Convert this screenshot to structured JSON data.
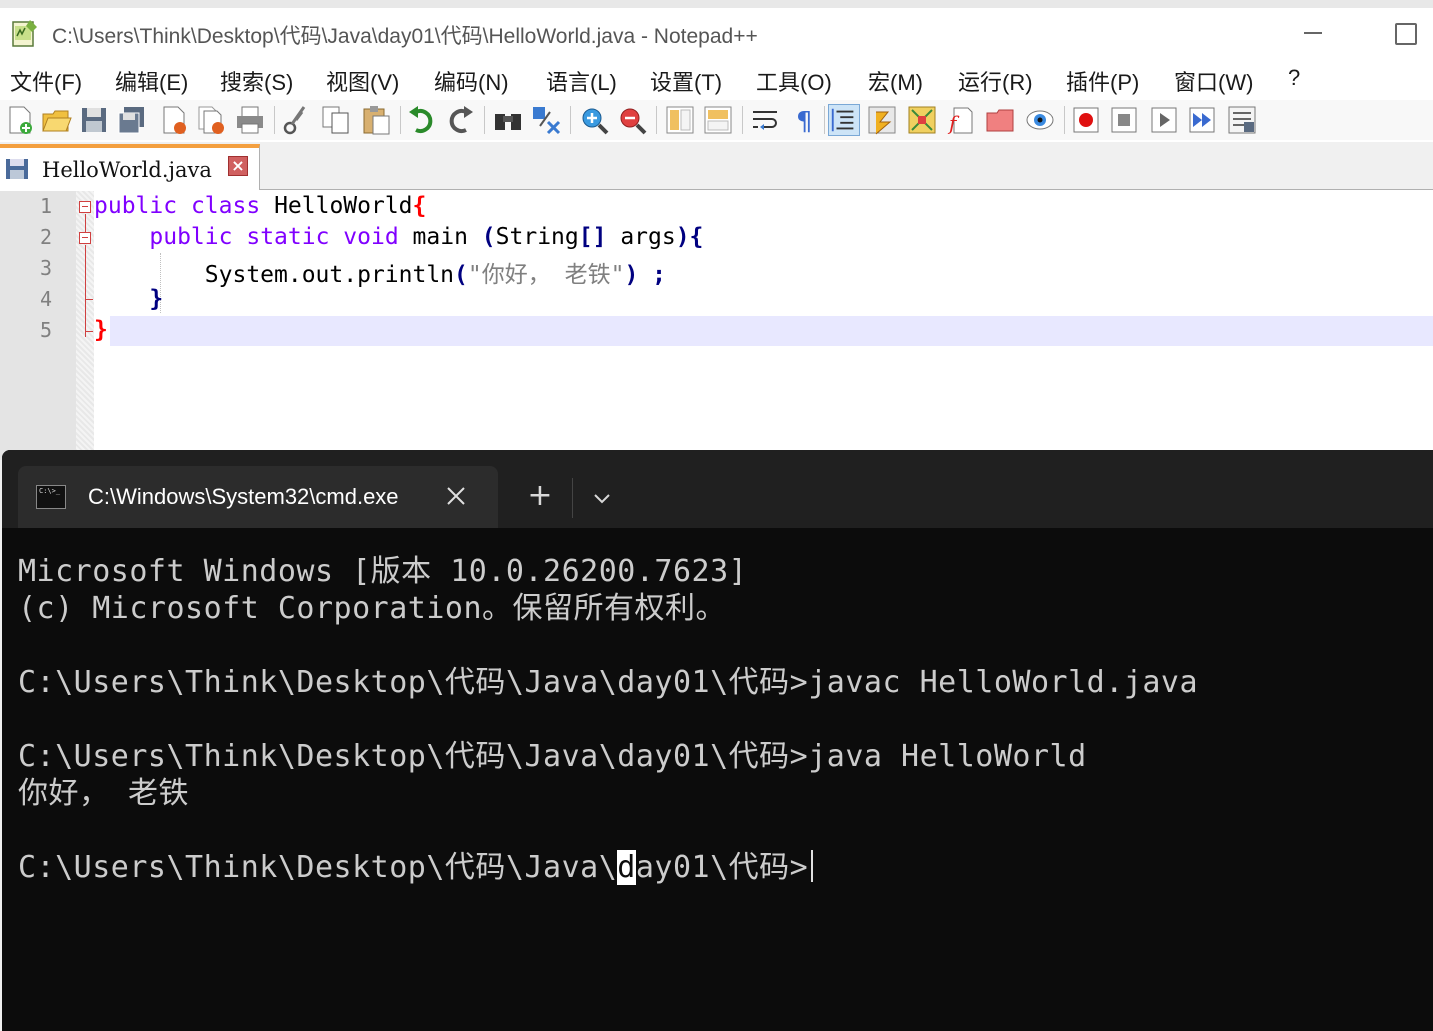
{
  "notepad": {
    "title": "C:\\Users\\Think\\Desktop\\代码\\Java\\day01\\代码\\HelloWorld.java - Notepad++",
    "menu": [
      "文件(F)",
      "编辑(E)",
      "搜索(S)",
      "视图(V)",
      "编码(N)",
      "语言(L)",
      "设置(T)",
      "工具(O)",
      "宏(M)",
      "运行(R)",
      "插件(P)",
      "窗口(W)",
      "?"
    ],
    "tab": {
      "label": "HelloWorld.java",
      "close": "×"
    },
    "line_numbers": [
      "1",
      "2",
      "3",
      "4",
      "5"
    ],
    "code": {
      "l1_kw1": "public",
      "l1_kw2": "class",
      "l1_name": "HelloWorld",
      "l1_brace": "{",
      "l2_kw1": "public",
      "l2_kw2": "static",
      "l2_kw3": "void",
      "l2_name": "main",
      "l2_paren_open": "(",
      "l2_type": "String",
      "l2_brackets": "[]",
      "l2_arg": "args",
      "l2_paren_close": "){",
      "l3_call": "System.out.println",
      "l3_paren_open": "(",
      "l3_string": "\"你好， 老铁\"",
      "l3_paren_close": ")",
      "l3_semi": ";",
      "l4_brace": "}",
      "l5_brace": "}"
    },
    "toolbar_icons": [
      "new-file-icon",
      "open-file-icon",
      "save-icon",
      "save-all-icon",
      "close-icon",
      "close-all-icon",
      "print-icon",
      "cut-icon",
      "copy-icon",
      "paste-icon",
      "undo-icon",
      "redo-icon",
      "find-icon",
      "replace-icon",
      "zoom-in-icon",
      "zoom-out-icon",
      "sync-vertical-icon",
      "sync-horizontal-icon",
      "word-wrap-icon",
      "show-all-chars-icon",
      "indent-guide-icon",
      "udl-icon",
      "doc-map-icon",
      "function-list-icon",
      "folder-workspace-icon",
      "monitoring-icon",
      "record-macro-icon",
      "stop-record-icon",
      "play-macro-icon",
      "run-macro-multiple-icon",
      "save-macro-icon"
    ]
  },
  "terminal": {
    "tab_title": "C:\\Windows\\System32\\cmd.exe",
    "tab_icon_text": "C:\\>_",
    "new_tab": "+",
    "lines": [
      "Microsoft Windows [版本 10.0.26200.7623]",
      "(c) Microsoft Corporation。保留所有权利。",
      "",
      "C:\\Users\\Think\\Desktop\\代码\\Java\\day01\\代码>javac HelloWorld.java",
      "",
      "C:\\Users\\Think\\Desktop\\代码\\Java\\day01\\代码>java HelloWorld",
      "你好， 老铁"
    ],
    "prompt_before_cursor": "C:\\Users\\Think\\Desktop\\代码\\Java\\",
    "prompt_cursor_char": "d",
    "prompt_after_cursor": "ay01\\代码>"
  },
  "colors": {
    "keyword": "#8000ff",
    "operator": "#000080",
    "string": "#808080",
    "brace_match": "#ff0000",
    "terminal_bg": "#0c0c0c",
    "terminal_fg": "#cccccc"
  }
}
